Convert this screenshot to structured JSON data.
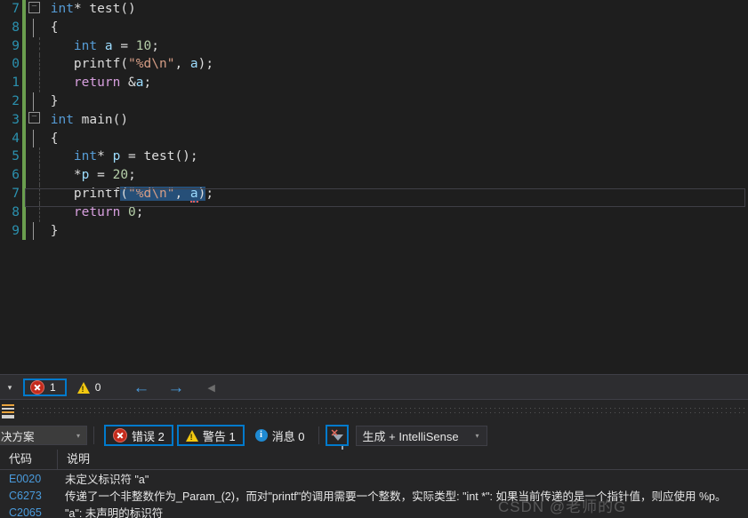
{
  "editor": {
    "language": "c",
    "lines": [
      {
        "num": "7",
        "fold": "collapse",
        "indent": 0,
        "tokens": [
          {
            "t": "int",
            "c": "kw"
          },
          {
            "t": "* ",
            "c": "punct"
          },
          {
            "t": "test",
            "c": "fn"
          },
          {
            "t": "()",
            "c": "punct"
          }
        ]
      },
      {
        "num": "8",
        "fold": "none",
        "brace": true,
        "indent": 0,
        "tokens": [
          {
            "t": "{",
            "c": "punct"
          }
        ]
      },
      {
        "num": "9",
        "fold": "none",
        "guide": true,
        "indent": 1,
        "tokens": [
          {
            "t": "int",
            "c": "kw"
          },
          {
            "t": " ",
            "c": "punct"
          },
          {
            "t": "a",
            "c": "var"
          },
          {
            "t": " = ",
            "c": "punct"
          },
          {
            "t": "10",
            "c": "num"
          },
          {
            "t": ";",
            "c": "punct"
          }
        ]
      },
      {
        "num": "0",
        "fold": "none",
        "guide": true,
        "indent": 1,
        "tokens": [
          {
            "t": "printf",
            "c": "fn"
          },
          {
            "t": "(",
            "c": "punct"
          },
          {
            "t": "\"%d\\n\"",
            "c": "str"
          },
          {
            "t": ", ",
            "c": "punct"
          },
          {
            "t": "a",
            "c": "var"
          },
          {
            "t": ")",
            "c": "punct"
          },
          {
            "t": ";",
            "c": "punct"
          }
        ]
      },
      {
        "num": "1",
        "fold": "none",
        "guide": true,
        "indent": 1,
        "tokens": [
          {
            "t": "return",
            "c": "kw2"
          },
          {
            "t": " &",
            "c": "punct"
          },
          {
            "t": "a",
            "c": "var"
          },
          {
            "t": ";",
            "c": "punct"
          }
        ]
      },
      {
        "num": "2",
        "fold": "none",
        "brace": true,
        "indent": 0,
        "tokens": [
          {
            "t": "}",
            "c": "punct"
          }
        ]
      },
      {
        "num": "3",
        "fold": "collapse",
        "indent": 0,
        "tokens": [
          {
            "t": "int",
            "c": "kw"
          },
          {
            "t": " ",
            "c": "punct"
          },
          {
            "t": "main",
            "c": "fn"
          },
          {
            "t": "()",
            "c": "punct"
          }
        ]
      },
      {
        "num": "4",
        "fold": "none",
        "brace": true,
        "indent": 0,
        "tokens": [
          {
            "t": "{",
            "c": "punct"
          }
        ]
      },
      {
        "num": "5",
        "fold": "none",
        "guide": true,
        "indent": 1,
        "tokens": [
          {
            "t": "int",
            "c": "kw"
          },
          {
            "t": "* ",
            "c": "punct"
          },
          {
            "t": "p",
            "c": "var"
          },
          {
            "t": " = ",
            "c": "punct"
          },
          {
            "t": "test",
            "c": "fn"
          },
          {
            "t": "()",
            "c": "punct"
          },
          {
            "t": ";",
            "c": "punct"
          }
        ]
      },
      {
        "num": "6",
        "fold": "none",
        "guide": true,
        "indent": 1,
        "tokens": [
          {
            "t": "*",
            "c": "punct"
          },
          {
            "t": "p",
            "c": "var"
          },
          {
            "t": " = ",
            "c": "punct"
          },
          {
            "t": "20",
            "c": "num"
          },
          {
            "t": ";",
            "c": "punct"
          }
        ]
      },
      {
        "num": "7",
        "fold": "none",
        "guide": true,
        "indent": 1,
        "current": true,
        "tokens": [
          {
            "t": "printf",
            "c": "fn"
          },
          {
            "t": "(",
            "c": "punct",
            "sel": true
          },
          {
            "t": "\"%d\\n\"",
            "c": "str",
            "sel": true
          },
          {
            "t": ", ",
            "c": "punct",
            "sel": true
          },
          {
            "t": "a",
            "c": "var",
            "sel": true,
            "squiggle": true
          },
          {
            "t": ")",
            "c": "punct",
            "sel": true
          },
          {
            "t": ";",
            "c": "punct"
          }
        ]
      },
      {
        "num": "8",
        "fold": "none",
        "guide": true,
        "indent": 1,
        "tokens": [
          {
            "t": "return",
            "c": "kw2"
          },
          {
            "t": " ",
            "c": "punct"
          },
          {
            "t": "0",
            "c": "num"
          },
          {
            "t": ";",
            "c": "punct"
          }
        ]
      },
      {
        "num": "9",
        "fold": "none",
        "brace": true,
        "indent": 0,
        "tokens": [
          {
            "t": "}",
            "c": "punct"
          }
        ]
      }
    ]
  },
  "navbar": {
    "scope_caret": "▾",
    "error_icon": "error-icon",
    "error_count": "1",
    "warning_icon": "warning-icon",
    "warning_count": "0",
    "back_arrow": "←",
    "forward_arrow": "→",
    "overflow_caret": "◀"
  },
  "error_list": {
    "scope_value": "决方案",
    "scope_caret": "▾",
    "filters": [
      {
        "name": "errors",
        "icon": "error-icon",
        "label": "错误 2",
        "active": true
      },
      {
        "name": "warnings",
        "icon": "warning-icon",
        "label": "警告 1",
        "active": true
      },
      {
        "name": "messages",
        "icon": "info-icon",
        "label": "消息 0",
        "active": false
      }
    ],
    "clear_filter_name": "clear-filter-icon",
    "build_scope": "生成 + IntelliSense",
    "build_caret": "▾",
    "columns": [
      "代码",
      "说明"
    ],
    "rows": [
      {
        "code": "E0020",
        "desc": "未定义标识符 \"a\""
      },
      {
        "code": "C6273",
        "desc": "传递了一个非整数作为_Param_(2)，而对\"printf\"的调用需要一个整数，实际类型: \"int *\": 如果当前传递的是一个指针值，则应使用 %p。"
      },
      {
        "code": "C2065",
        "desc": "\"a\": 未声明的标识符"
      }
    ]
  },
  "watermark": "CSDN @老师的G",
  "colors": {
    "background": "#1e1e1e",
    "panel": "#252526",
    "toolbar": "#2d2d30",
    "accent": "#007acc",
    "keyword": "#569cd6",
    "keyword_control": "#d8a0df",
    "string": "#d69d85",
    "number": "#b5cea8",
    "variable": "#9cdcfe",
    "linenumber": "#2b91af",
    "selection": "#264f78",
    "error": "#c42b1c",
    "warning": "#f2c811",
    "info": "#1f8ad2",
    "changed_bar": "#6a9e4f"
  }
}
